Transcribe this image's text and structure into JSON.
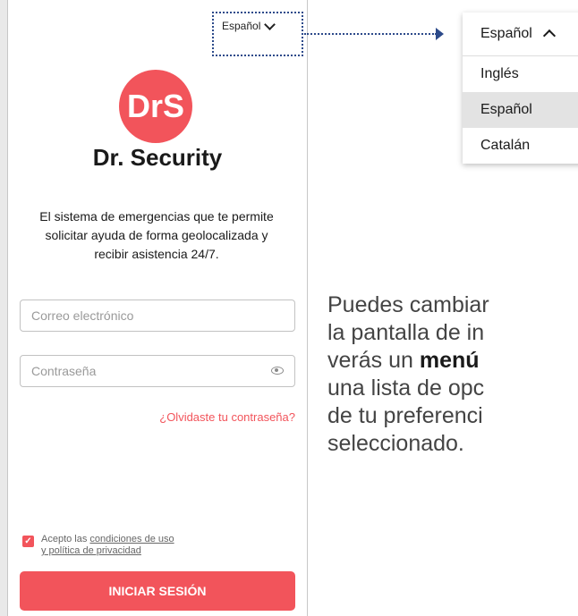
{
  "app": {
    "language_button": "Español",
    "brand_name": "Dr. Security",
    "logo_text": "DrS",
    "tagline": "El sistema de emergencias que te permite solicitar ayuda de forma geolocalizada y recibir asistencia 24/7.",
    "email_placeholder": "Correo electrónico",
    "password_placeholder": "Contraseña",
    "forgot_password": "¿Olvidaste tu contraseña?",
    "terms_prefix": "Acepto las ",
    "terms_link_1": "condiciones de uso",
    "terms_link_2": "y política de privacidad",
    "login_button": "INICIAR SESIÓN",
    "terms_checked": true
  },
  "language_menu": {
    "current": "Español",
    "options": [
      "Inglés",
      "Español",
      "Catalán"
    ],
    "selected": "Español"
  },
  "description": {
    "line1": "Puedes cambiar",
    "line2": "la pantalla de in",
    "line3_prefix": "verás un ",
    "line3_bold": "menú",
    "line4": "una lista de opc",
    "line5": "de tu preferenci",
    "line6": "seleccionado."
  },
  "colors": {
    "accent": "#f2545b",
    "callout": "#2c4a8a"
  }
}
